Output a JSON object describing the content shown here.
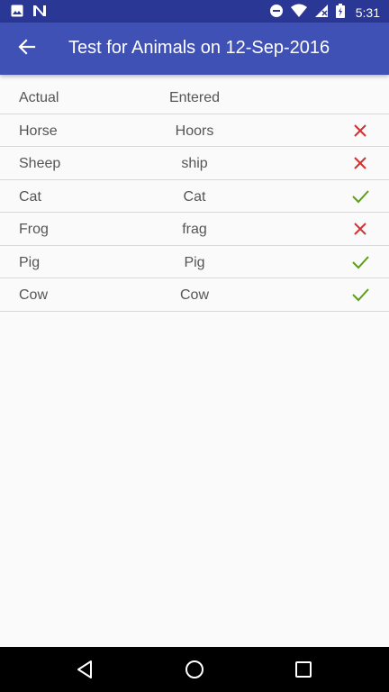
{
  "status_bar": {
    "time": "5:31",
    "left_icons": [
      "image-icon",
      "n-notification-icon"
    ],
    "right_icons": [
      "do-not-disturb-icon",
      "wifi-icon",
      "signal-icon",
      "battery-icon"
    ]
  },
  "toolbar": {
    "title": "Test for Animals on 12-Sep-2016",
    "back_icon": "arrow-left-icon"
  },
  "table": {
    "headers": {
      "actual": "Actual",
      "entered": "Entered"
    },
    "rows": [
      {
        "actual": "Horse",
        "entered": "Hoors",
        "result": "incorrect"
      },
      {
        "actual": "Sheep",
        "entered": "ship",
        "result": "incorrect"
      },
      {
        "actual": "Cat",
        "entered": "Cat",
        "result": "correct"
      },
      {
        "actual": "Frog",
        "entered": "frag",
        "result": "incorrect"
      },
      {
        "actual": "Pig",
        "entered": "Pig",
        "result": "correct"
      },
      {
        "actual": "Cow",
        "entered": "Cow",
        "result": "correct"
      }
    ]
  },
  "colors": {
    "primary": "#3f51b5",
    "primary_dark": "#2a3795",
    "correct": "#5a9e1a",
    "incorrect": "#d32f2f"
  },
  "nav_bar": {
    "buttons": [
      "back-triangle-icon",
      "home-circle-icon",
      "recents-square-icon"
    ]
  }
}
